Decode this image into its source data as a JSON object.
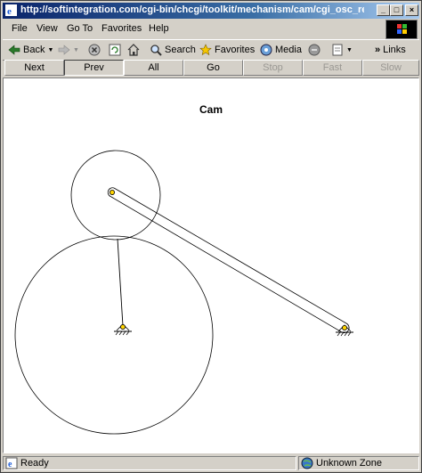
{
  "window": {
    "title": "http://softintegration.com/cgi-bin/chcgi/toolkit/mechanism/cam/cgi_osc_re..."
  },
  "menu": [
    "File",
    "View",
    "Go To",
    "Favorites",
    "Help"
  ],
  "toolbar": {
    "back": "Back",
    "search": "Search",
    "favorites": "Favorites",
    "media": "Media",
    "links": "Links"
  },
  "nav_buttons": [
    {
      "label": "Next",
      "state": "normal"
    },
    {
      "label": "Prev",
      "state": "pressed"
    },
    {
      "label": "All",
      "state": "normal"
    },
    {
      "label": "Go",
      "state": "normal"
    },
    {
      "label": "Stop",
      "state": "disabled"
    },
    {
      "label": "Fast",
      "state": "disabled"
    },
    {
      "label": "Slow",
      "state": "disabled"
    }
  ],
  "page": {
    "heading": "Cam"
  },
  "status": {
    "text": "Ready",
    "zone": "Unknown Zone"
  },
  "colors": {
    "titlebar_start": "#0a246a",
    "titlebar_end": "#a6caf0",
    "chrome": "#d4d0c8",
    "pin": "#ffd400"
  }
}
